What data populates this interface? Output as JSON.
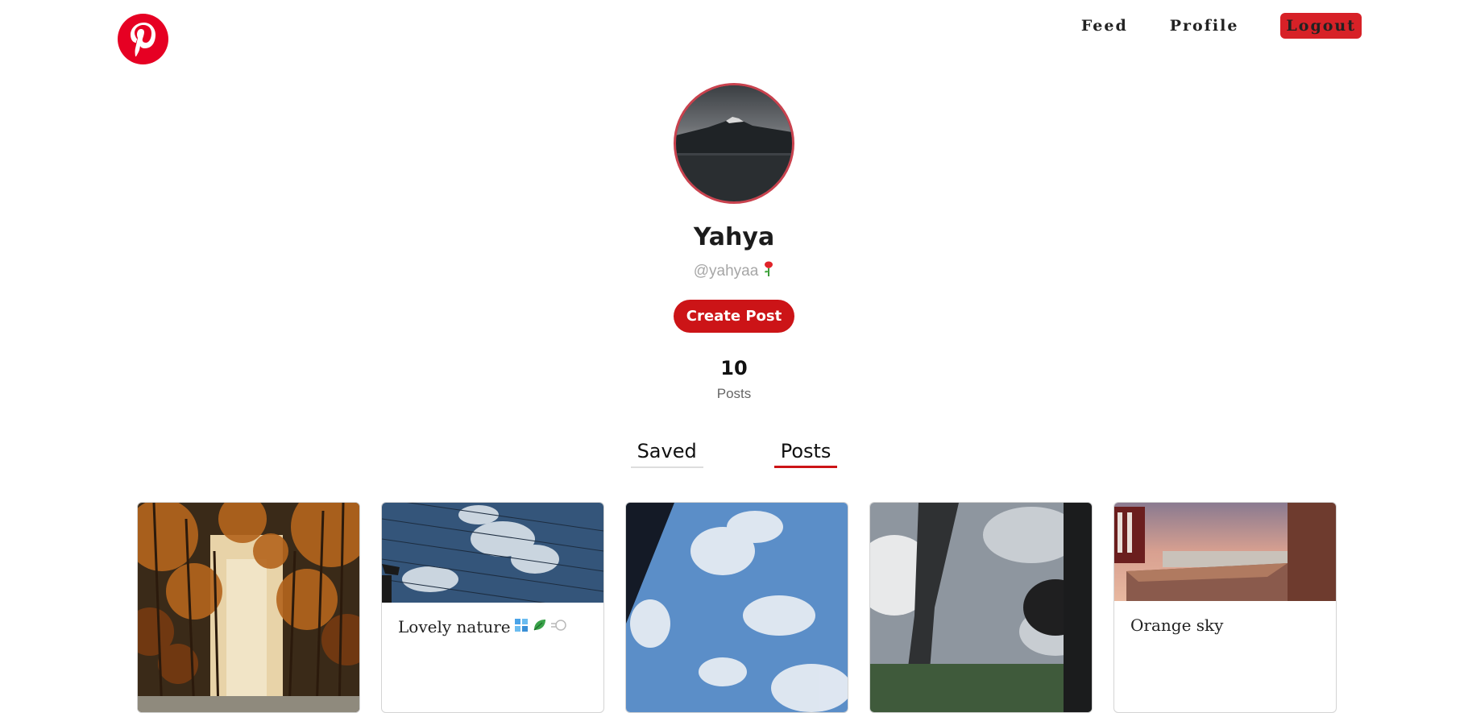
{
  "nav": {
    "feed": "Feed",
    "profile": "Profile",
    "logout": "Logout"
  },
  "profile": {
    "name": "Yahya",
    "handle": "@yahyaa",
    "create_post": "Create Post",
    "post_count": "10",
    "post_count_label": "Posts"
  },
  "tabs": {
    "saved": "Saved",
    "posts": "Posts",
    "active": "Posts"
  },
  "posts": [
    {
      "caption": ""
    },
    {
      "caption": "Lovely nature"
    },
    {
      "caption": ""
    },
    {
      "caption": ""
    },
    {
      "caption": "Orange sky"
    }
  ],
  "colors": {
    "brand": "#e60023",
    "button": "#cc1417"
  }
}
